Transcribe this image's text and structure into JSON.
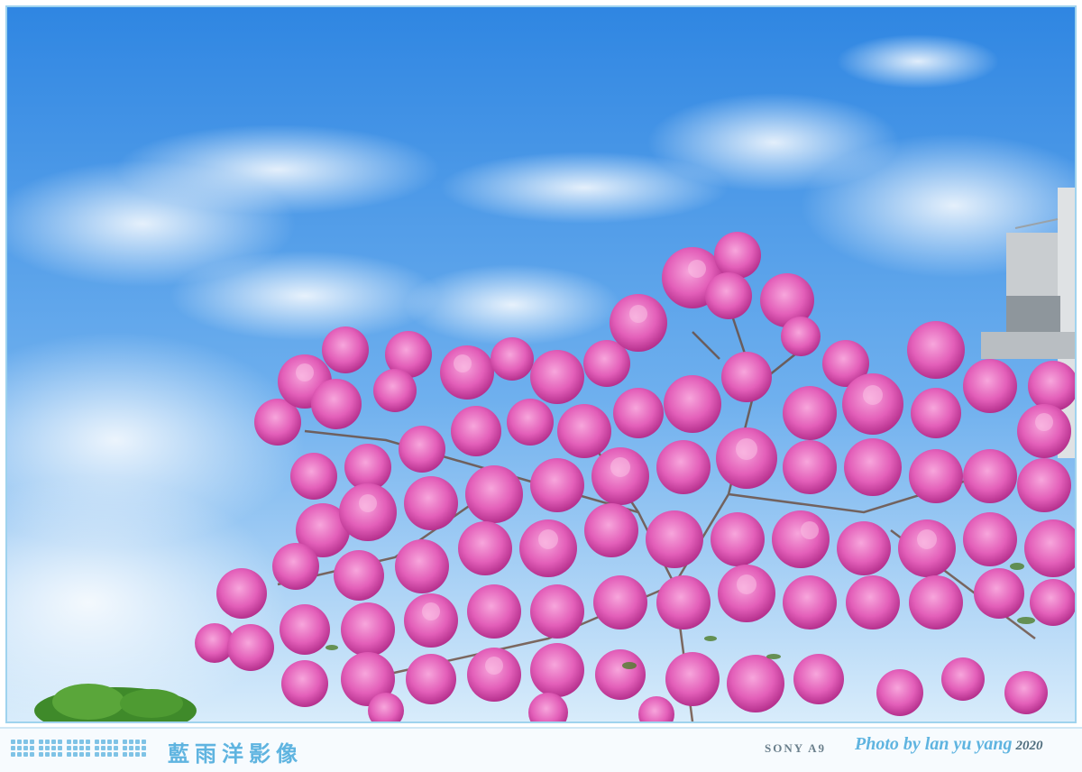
{
  "footer": {
    "studio_name": "藍雨洋影像",
    "camera_model": "SONY A9",
    "credit": "Photo by lan yu yang",
    "year": "2020"
  },
  "colors": {
    "sky_top": "#3b8fe6",
    "sky_bottom": "#b9dcf7",
    "blossom_pink": "#e04fb0",
    "blossom_light": "#f08acb",
    "frame_border": "#9fd3ee",
    "footer_accent": "#5fb4e0"
  }
}
